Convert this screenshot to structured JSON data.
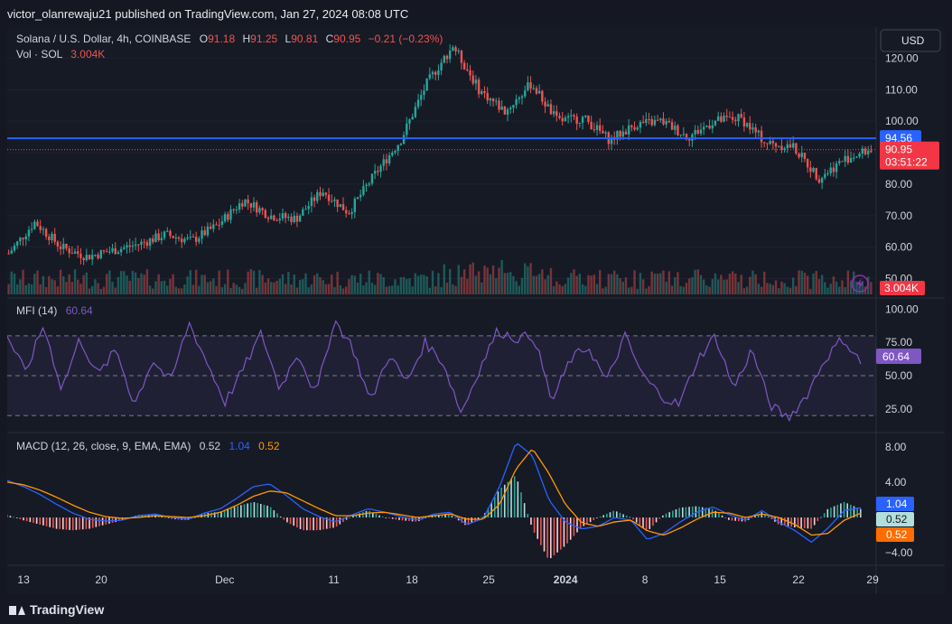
{
  "header": {
    "published": "victor_olanrewaju21 published on TradingView.com, Jan 27, 2024 08:08 UTC"
  },
  "footer": {
    "brand": "TradingView"
  },
  "currency_button": "USD",
  "colors": {
    "up": "#26a69a",
    "down": "#ef5350",
    "level": "#2962ff",
    "mfi": "#7e57c2",
    "macd": "#2962ff",
    "signal": "#ff9800",
    "bg": "#161a25"
  },
  "chart_data": [
    {
      "type": "candlestick",
      "title": "Solana / U.S. Dollar, 4h, COINBASE",
      "ohlc_labels": {
        "o_key": "O",
        "o": "91.18",
        "h_key": "H",
        "h": "91.25",
        "l_key": "L",
        "l": "90.81",
        "c_key": "C",
        "c": "90.95",
        "change": "−0.21 (−0.23%)"
      },
      "volume_label": "Vol · SOL",
      "volume_value": "3.004K",
      "y_ticks": [
        "120.00",
        "110.00",
        "100.00",
        "90.00",
        "80.00",
        "70.00",
        "60.00",
        "50.00"
      ],
      "ylim": [
        45,
        127
      ],
      "horizontal_line": {
        "value": 94.56,
        "label": "94.56"
      },
      "last_price": {
        "value": 90.95,
        "label": "90.95",
        "countdown": "03:51:22"
      },
      "volume_badge": "3.004K",
      "x_tick_labels": [
        "13",
        "20",
        "Dec",
        "11",
        "18",
        "25",
        "2024",
        "8",
        "15",
        "22",
        "29"
      ],
      "approx_close_path": [
        {
          "x": "Nov 13",
          "y": 58
        },
        {
          "x": "Nov 15",
          "y": 68
        },
        {
          "x": "Nov 18",
          "y": 60
        },
        {
          "x": "Nov 22",
          "y": 57
        },
        {
          "x": "Nov 25",
          "y": 59
        },
        {
          "x": "Nov 29",
          "y": 61
        },
        {
          "x": "Dec 2",
          "y": 64
        },
        {
          "x": "Dec 5",
          "y": 62
        },
        {
          "x": "Dec 8",
          "y": 67
        },
        {
          "x": "Dec 10",
          "y": 75
        },
        {
          "x": "Dec 12",
          "y": 70
        },
        {
          "x": "Dec 14",
          "y": 69
        },
        {
          "x": "Dec 16",
          "y": 78
        },
        {
          "x": "Dec 18",
          "y": 71
        },
        {
          "x": "Dec 20",
          "y": 83
        },
        {
          "x": "Dec 22",
          "y": 94
        },
        {
          "x": "Dec 24",
          "y": 112
        },
        {
          "x": "Dec 25",
          "y": 124
        },
        {
          "x": "Dec 27",
          "y": 110
        },
        {
          "x": "Dec 30",
          "y": 103
        },
        {
          "x": "Jan 2",
          "y": 112
        },
        {
          "x": "Jan 3",
          "y": 100
        },
        {
          "x": "Jan 5",
          "y": 101
        },
        {
          "x": "Jan 7",
          "y": 94
        },
        {
          "x": "Jan 9",
          "y": 99
        },
        {
          "x": "Jan 11",
          "y": 100
        },
        {
          "x": "Jan 13",
          "y": 95
        },
        {
          "x": "Jan 15",
          "y": 100
        },
        {
          "x": "Jan 17",
          "y": 101
        },
        {
          "x": "Jan 19",
          "y": 93
        },
        {
          "x": "Jan 21",
          "y": 92
        },
        {
          "x": "Jan 23",
          "y": 82
        },
        {
          "x": "Jan 25",
          "y": 88
        },
        {
          "x": "Jan 27",
          "y": 91
        }
      ]
    },
    {
      "type": "line",
      "title": "MFI (14)",
      "value_label": "60.64",
      "y_ticks": [
        "100.00",
        "75.00",
        "50.00",
        "25.00"
      ],
      "ylim": [
        10,
        105
      ],
      "bands": [
        80,
        50,
        20
      ],
      "approx_values": [
        80,
        52,
        88,
        40,
        78,
        50,
        70,
        28,
        62,
        45,
        90,
        60,
        30,
        55,
        82,
        40,
        68,
        35,
        92,
        72,
        30,
        66,
        45,
        75,
        60,
        22,
        55,
        84,
        78,
        80,
        30,
        62,
        72,
        45,
        80,
        50,
        35,
        28,
        62,
        80,
        40,
        70,
        28,
        18,
        35,
        62,
        78,
        60
      ]
    },
    {
      "type": "line",
      "title": "MACD (12, 26, close, 9, EMA, EMA)",
      "values_label": {
        "macd": "0.52",
        "signal": "1.04",
        "hist": "0.52"
      },
      "badges": {
        "a": "1.04",
        "b": "0.52",
        "c": "0.52"
      },
      "y_ticks": [
        "8.00",
        "4.00",
        "0.00",
        "−4.00"
      ],
      "ylim": [
        -5,
        9
      ],
      "approx_macd": [
        4.2,
        3.5,
        2.6,
        1.5,
        0.5,
        -0.2,
        -0.4,
        -0.3,
        0.2,
        0.4,
        0.0,
        -0.2,
        0.5,
        1.0,
        2.2,
        3.5,
        3.8,
        2.5,
        1.0,
        0.1,
        -0.5,
        0.3,
        1.0,
        0.6,
        0.1,
        -0.3,
        0.4,
        0.6,
        -0.8,
        -0.1,
        3.5,
        8.5,
        7.0,
        2.0,
        -0.5,
        -1.3,
        -1.0,
        0.0,
        -0.3,
        -2.5,
        -1.8,
        -0.5,
        0.6,
        1.2,
        0.3,
        -0.3,
        0.8,
        -0.5,
        -1.5,
        -2.8,
        -1.2,
        0.8,
        1.1
      ],
      "approx_signal": [
        4.0,
        3.7,
        3.1,
        2.3,
        1.4,
        0.6,
        0.1,
        -0.1,
        0.0,
        0.2,
        0.1,
        0.0,
        0.2,
        0.6,
        1.4,
        2.4,
        3.0,
        2.8,
        1.9,
        1.0,
        0.2,
        0.2,
        0.5,
        0.6,
        0.3,
        0.0,
        0.2,
        0.4,
        -0.2,
        -0.2,
        1.5,
        5.5,
        7.8,
        5.0,
        1.5,
        -0.6,
        -1.0,
        -0.5,
        -0.3,
        -1.5,
        -2.0,
        -1.2,
        -0.2,
        0.6,
        0.5,
        0.0,
        0.4,
        0.0,
        -0.8,
        -2.0,
        -1.8,
        -0.3,
        0.5
      ]
    }
  ]
}
